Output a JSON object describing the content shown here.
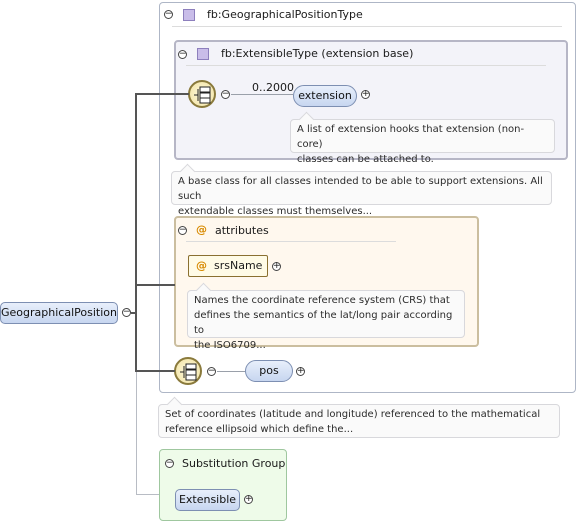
{
  "type_box": {
    "title": "fb:GeographicalPositionType"
  },
  "extension_base": {
    "title": "fb:ExtensibleType (extension base)",
    "occurs": "0..2000",
    "element": "extension",
    "doc": [
      "A list of extension hooks that extension (non-core)",
      "classes can be attached to."
    ]
  },
  "type_doc": [
    "A base class for all classes intended to be able to support extensions. All such",
    "extendable classes must themselves..."
  ],
  "attributes": {
    "title": "attributes",
    "attr_name": "srsName",
    "doc": [
      "Names the coordinate reference system (CRS) that",
      "defines the semantics of the lat/long pair according to",
      "the ISO6709..."
    ]
  },
  "root_element": "GeographicalPosition",
  "pos_element": "pos",
  "root_doc": [
    "Set of coordinates (latitude and longitude) referenced to the mathematical",
    "reference ellipsoid which define the..."
  ],
  "substitution": {
    "title": "Substitution Group",
    "element": "Extensible"
  },
  "symbols": {
    "collapse": "−",
    "expand": "+",
    "attr": "@"
  }
}
